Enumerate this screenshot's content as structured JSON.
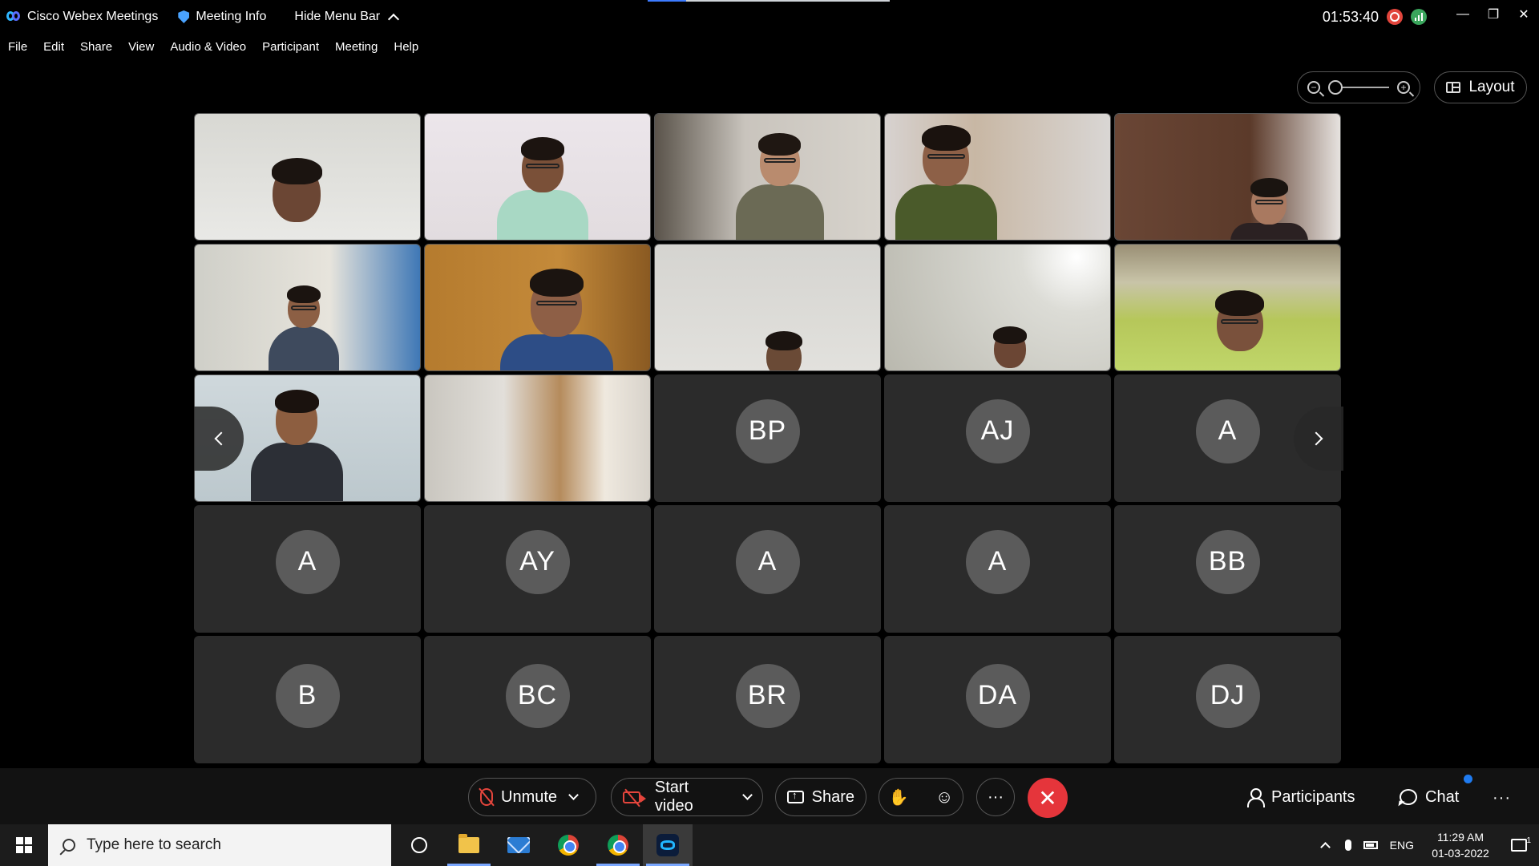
{
  "titlebar": {
    "app_name": "Cisco Webex Meetings",
    "meeting_info": "Meeting Info",
    "hide_menu_bar": "Hide Menu Bar",
    "elapsed_time": "01:53:40",
    "progress_fraction": 0.16
  },
  "menubar": {
    "items": [
      "File",
      "Edit",
      "Share",
      "View",
      "Audio & Video",
      "Participant",
      "Meeting",
      "Help"
    ]
  },
  "view_controls": {
    "layout_label": "Layout"
  },
  "tiles": [
    {
      "type": "video",
      "scene": "person-back-head"
    },
    {
      "type": "video",
      "scene": "person-glasses-looking-down"
    },
    {
      "type": "video",
      "scene": "person-with-bed"
    },
    {
      "type": "video",
      "scene": "person-glasses-green-shirt"
    },
    {
      "type": "video",
      "scene": "woman-glasses-wardrobe"
    },
    {
      "type": "video",
      "scene": "girl-headphones-phone"
    },
    {
      "type": "video",
      "scene": "man-glasses-wooden-door"
    },
    {
      "type": "video",
      "scene": "top-of-head-white-wall"
    },
    {
      "type": "video",
      "scene": "man-bright-window"
    },
    {
      "type": "video",
      "scene": "man-glasses-yellow-wall"
    },
    {
      "type": "video",
      "scene": "man-black-tshirt"
    },
    {
      "type": "video",
      "scene": "empty-room-window"
    },
    {
      "type": "avatar",
      "initials": "BP"
    },
    {
      "type": "avatar",
      "initials": "AJ"
    },
    {
      "type": "avatar",
      "initials": "A"
    },
    {
      "type": "avatar",
      "initials": "A"
    },
    {
      "type": "avatar",
      "initials": "AY"
    },
    {
      "type": "avatar",
      "initials": "A"
    },
    {
      "type": "avatar",
      "initials": "A"
    },
    {
      "type": "avatar",
      "initials": "BB"
    },
    {
      "type": "avatar",
      "initials": "B"
    },
    {
      "type": "avatar",
      "initials": "BC"
    },
    {
      "type": "avatar",
      "initials": "BR"
    },
    {
      "type": "avatar",
      "initials": "DA"
    },
    {
      "type": "avatar",
      "initials": "DJ"
    }
  ],
  "controls": {
    "unmute": "Unmute",
    "start_video": "Start video",
    "share": "Share",
    "more": "···",
    "end": "✕",
    "participants": "Participants",
    "chat": "Chat",
    "overflow": "···"
  },
  "taskbar": {
    "search_placeholder": "Type here to search",
    "language": "ENG",
    "time": "11:29 AM",
    "date": "01-03-2022",
    "notification_count": "1"
  },
  "colors": {
    "end_call": "#e5353b",
    "muted_red": "#e5453c",
    "recording": "#e2453c",
    "network": "#3aa55c",
    "chat_badge": "#1f7bf0"
  }
}
